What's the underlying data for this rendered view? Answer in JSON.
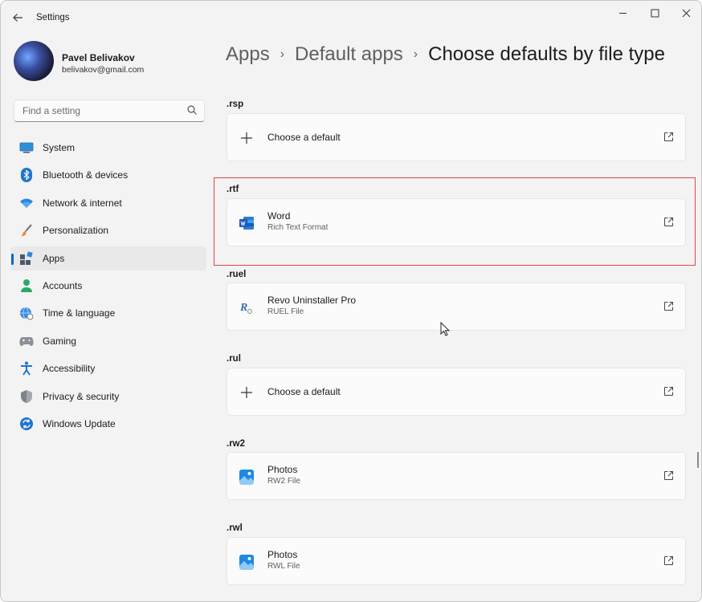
{
  "window": {
    "title": "Settings"
  },
  "profile": {
    "name": "Pavel Belivakov",
    "email": "belivakov@gmail.com"
  },
  "search": {
    "placeholder": "Find a setting"
  },
  "sidebar": {
    "items": [
      {
        "label": "System",
        "icon": "system-icon"
      },
      {
        "label": "Bluetooth & devices",
        "icon": "bluetooth-icon"
      },
      {
        "label": "Network & internet",
        "icon": "wifi-icon"
      },
      {
        "label": "Personalization",
        "icon": "brush-icon"
      },
      {
        "label": "Apps",
        "icon": "apps-icon",
        "selected": true
      },
      {
        "label": "Accounts",
        "icon": "person-icon"
      },
      {
        "label": "Time & language",
        "icon": "globe-icon"
      },
      {
        "label": "Gaming",
        "icon": "gamepad-icon"
      },
      {
        "label": "Accessibility",
        "icon": "accessibility-icon"
      },
      {
        "label": "Privacy & security",
        "icon": "shield-icon"
      },
      {
        "label": "Windows Update",
        "icon": "update-icon"
      }
    ]
  },
  "breadcrumb": {
    "level1": "Apps",
    "level2": "Default apps",
    "current": "Choose defaults by file type",
    "separator": "›"
  },
  "file_types": [
    {
      "ext": ".rsp",
      "app": "Choose a default",
      "subtitle": "",
      "icon": "plus-icon"
    },
    {
      "ext": ".rtf",
      "app": "Word",
      "subtitle": "Rich Text Format",
      "icon": "word-icon",
      "highlighted": true
    },
    {
      "ext": ".ruel",
      "app": "Revo Uninstaller Pro",
      "subtitle": "RUEL File",
      "icon": "revo-uninstaller-icon"
    },
    {
      "ext": ".rul",
      "app": "Choose a default",
      "subtitle": "",
      "icon": "plus-icon"
    },
    {
      "ext": ".rw2",
      "app": "Photos",
      "subtitle": "RW2 File",
      "icon": "photos-icon"
    },
    {
      "ext": ".rwl",
      "app": "Photos",
      "subtitle": "RWL File",
      "icon": "photos-icon"
    }
  ],
  "colors": {
    "accent": "#0067c0",
    "highlight_border": "#e04646",
    "background": "#f3f3f3",
    "card": "#fbfbfb"
  }
}
